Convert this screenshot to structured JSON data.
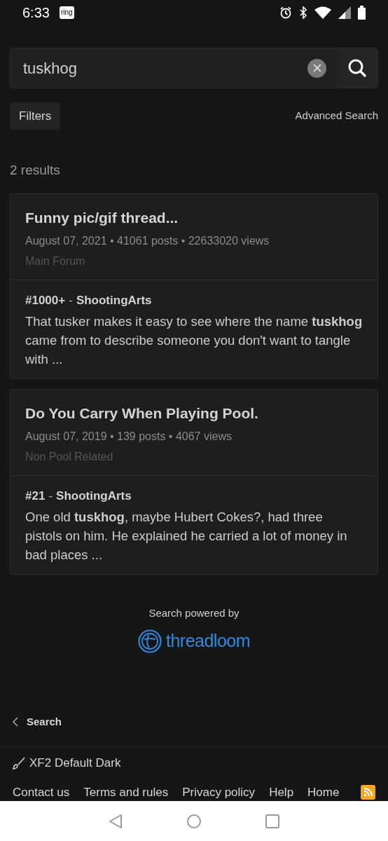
{
  "status_bar": {
    "time": "6:33",
    "app_badge": "ring"
  },
  "search": {
    "value": "tuskhog"
  },
  "filters_button": "Filters",
  "advanced_search": "Advanced Search",
  "result_count": "2 results",
  "results": [
    {
      "title": "Funny pic/gif thread...",
      "meta": "August 07, 2021 • 41061 posts • 22633020 views",
      "forum": "Main Forum",
      "post_ref": "#1000+",
      "separator": "-",
      "author": "ShootingArts",
      "snippet": "That tusker makes it easy to see where the name **tuskhog** came from to describe someone you don't want to tangle with ..."
    },
    {
      "title": "Do You Carry When Playing Pool.",
      "meta": "August 07, 2019 • 139 posts • 4067 views",
      "forum": "Non Pool Related",
      "post_ref": "#21",
      "separator": "-",
      "author": "ShootingArts",
      "snippet": "One old **tuskhog**, maybe Hubert Cokes?, had three pistols on him. He explained he carried a lot of money in bad places ..."
    }
  ],
  "powered_by": "Search powered by",
  "logo_text": "threadloom",
  "breadcrumb": "Search",
  "style_chooser": "XF2 Default Dark",
  "footer_links": [
    "Contact us",
    "Terms and rules",
    "Privacy policy",
    "Help",
    "Home"
  ]
}
